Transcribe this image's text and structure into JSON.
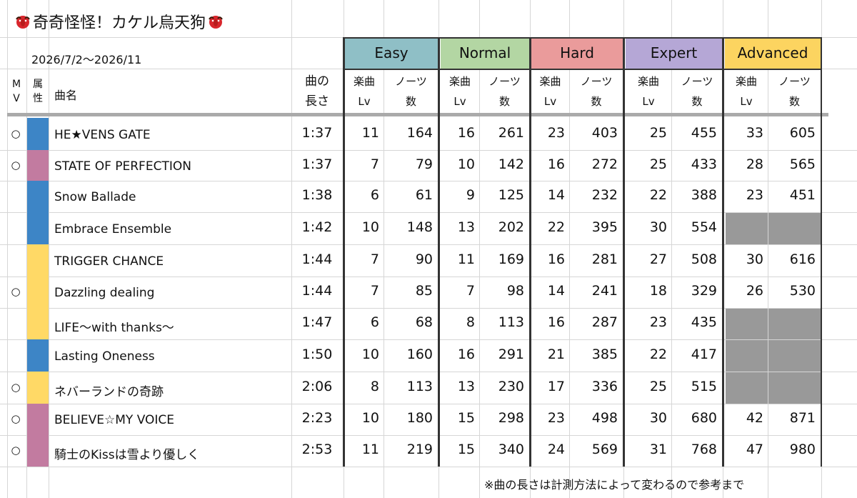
{
  "title": "奇奇怪怪！カケル烏天狗",
  "icons": {
    "left": "tengu-mask-icon",
    "right": "tengu-mask-icon"
  },
  "period": "2026/7/2〜2026/11",
  "headers": {
    "mv": "M V",
    "attr": "属 性",
    "name": "曲名",
    "length": "曲の 長さ",
    "lv": "楽曲 Lv",
    "notes": "ノーツ 数"
  },
  "difficulties": [
    {
      "label": "Easy",
      "color": "#8fbfc6"
    },
    {
      "label": "Normal",
      "color": "#b3d6a3"
    },
    {
      "label": "Hard",
      "color": "#ea9b9b"
    },
    {
      "label": "Expert",
      "color": "#b5a7d6"
    },
    {
      "label": "Advanced",
      "color": "#fcd460"
    }
  ],
  "attribute_colors": {
    "blue": "#3d85c6",
    "pink": "#c27ba0",
    "yellow": "#ffd966"
  },
  "blank_color": "#999999",
  "songs": [
    {
      "mv": "○",
      "attr": "blue",
      "name": "HE★VENS GATE",
      "length": "1:37",
      "easy": [
        "11",
        "164"
      ],
      "normal": [
        "16",
        "261"
      ],
      "hard": [
        "23",
        "403"
      ],
      "expert": [
        "25",
        "455"
      ],
      "advanced": [
        "33",
        "605"
      ]
    },
    {
      "mv": "○",
      "attr": "pink",
      "name": "STATE OF PERFECTION",
      "length": "1:37",
      "easy": [
        "7",
        "79"
      ],
      "normal": [
        "10",
        "142"
      ],
      "hard": [
        "16",
        "272"
      ],
      "expert": [
        "25",
        "433"
      ],
      "advanced": [
        "28",
        "565"
      ]
    },
    {
      "mv": "",
      "attr": "blue",
      "name": "Snow Ballade",
      "length": "1:38",
      "easy": [
        "6",
        "61"
      ],
      "normal": [
        "9",
        "125"
      ],
      "hard": [
        "14",
        "232"
      ],
      "expert": [
        "22",
        "388"
      ],
      "advanced": [
        "23",
        "451"
      ]
    },
    {
      "mv": "",
      "attr": "blue",
      "name": "Embrace Ensemble",
      "length": "1:42",
      "easy": [
        "10",
        "148"
      ],
      "normal": [
        "13",
        "202"
      ],
      "hard": [
        "22",
        "395"
      ],
      "expert": [
        "30",
        "554"
      ],
      "advanced": null
    },
    {
      "mv": "",
      "attr": "yellow",
      "name": "TRIGGER CHANCE",
      "length": "1:44",
      "easy": [
        "7",
        "90"
      ],
      "normal": [
        "11",
        "169"
      ],
      "hard": [
        "16",
        "281"
      ],
      "expert": [
        "27",
        "508"
      ],
      "advanced": [
        "30",
        "616"
      ]
    },
    {
      "mv": "○",
      "attr": "yellow",
      "name": "Dazzling dealing",
      "length": "1:44",
      "easy": [
        "7",
        "85"
      ],
      "normal": [
        "7",
        "98"
      ],
      "hard": [
        "14",
        "241"
      ],
      "expert": [
        "18",
        "329"
      ],
      "advanced": [
        "26",
        "530"
      ]
    },
    {
      "mv": "",
      "attr": "yellow",
      "name": "LIFE〜with thanks〜",
      "length": "1:47",
      "easy": [
        "6",
        "68"
      ],
      "normal": [
        "8",
        "113"
      ],
      "hard": [
        "16",
        "287"
      ],
      "expert": [
        "23",
        "435"
      ],
      "advanced": null
    },
    {
      "mv": "",
      "attr": "blue",
      "name": "Lasting Oneness",
      "length": "1:50",
      "easy": [
        "10",
        "160"
      ],
      "normal": [
        "16",
        "291"
      ],
      "hard": [
        "21",
        "385"
      ],
      "expert": [
        "22",
        "417"
      ],
      "advanced": null
    },
    {
      "mv": "○",
      "attr": "yellow",
      "name": "ネバーランドの奇跡",
      "length": "2:06",
      "easy": [
        "8",
        "113"
      ],
      "normal": [
        "13",
        "230"
      ],
      "hard": [
        "17",
        "336"
      ],
      "expert": [
        "25",
        "515"
      ],
      "advanced": null
    },
    {
      "mv": "○",
      "attr": "pink",
      "name": "BELIEVE☆MY VOICE",
      "length": "2:23",
      "easy": [
        "10",
        "180"
      ],
      "normal": [
        "15",
        "298"
      ],
      "hard": [
        "23",
        "498"
      ],
      "expert": [
        "30",
        "680"
      ],
      "advanced": [
        "42",
        "871"
      ]
    },
    {
      "mv": "○",
      "attr": "pink",
      "name": "騎士のKissは雪より優しく",
      "length": "2:53",
      "easy": [
        "11",
        "219"
      ],
      "normal": [
        "15",
        "340"
      ],
      "hard": [
        "24",
        "569"
      ],
      "expert": [
        "31",
        "768"
      ],
      "advanced": [
        "47",
        "980"
      ]
    }
  ],
  "note": "※曲の長さは計測方法によって変わるので参考まで"
}
